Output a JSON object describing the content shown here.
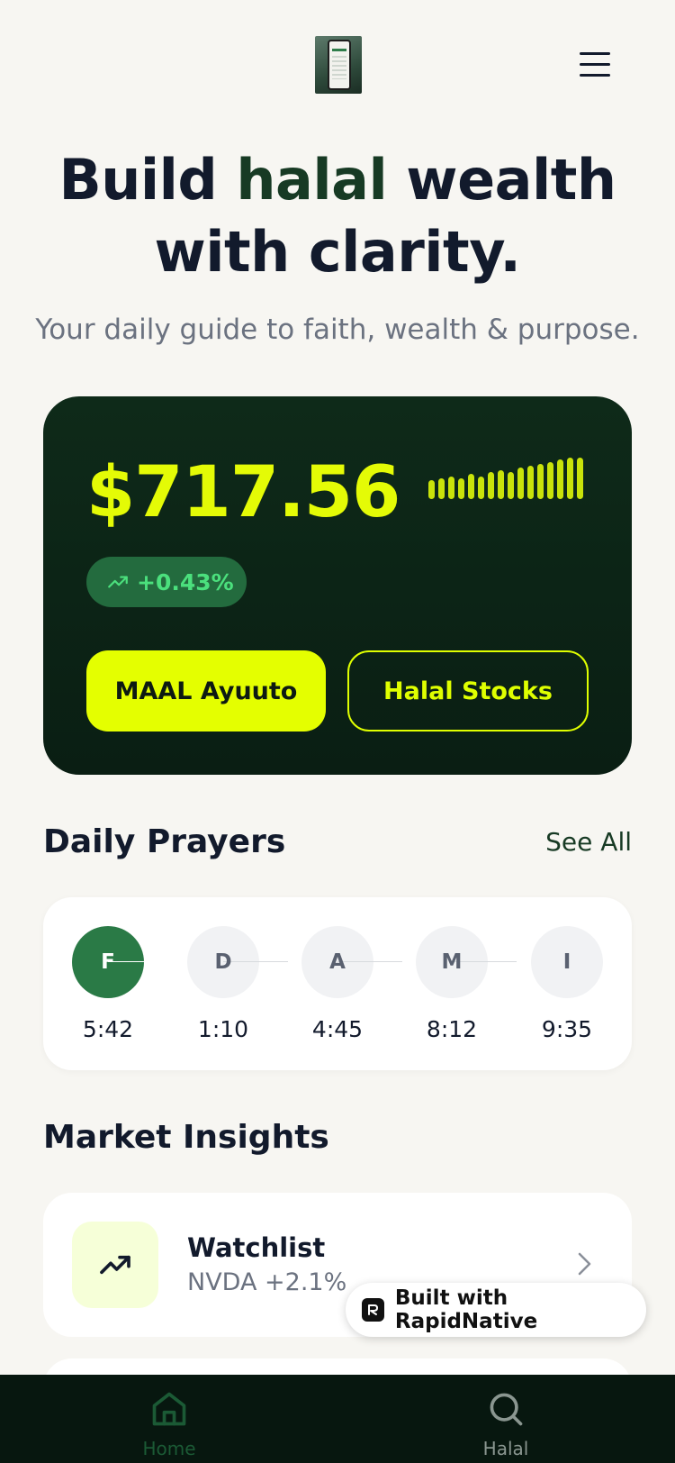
{
  "header": {
    "menu_label": "Menu"
  },
  "hero": {
    "title_part1": "Build ",
    "title_accent": "halal",
    "title_part2": " wealth",
    "title_line2": "with clarity.",
    "subtitle": "Your daily guide to faith, wealth & purpose."
  },
  "balance": {
    "amount": "$717.56",
    "change": "+0.43%",
    "primary_button": "MAAL Ayuuto",
    "secondary_button": "Halal Stocks",
    "bar_levels": [
      0.45,
      0.5,
      0.55,
      0.5,
      0.6,
      0.55,
      0.65,
      0.7,
      0.65,
      0.75,
      0.8,
      0.85,
      0.9,
      0.95,
      1.0,
      1.0
    ]
  },
  "prayers": {
    "title": "Daily Prayers",
    "see_all": "See All",
    "items": [
      {
        "letter": "F",
        "time": "5:42",
        "active": true
      },
      {
        "letter": "D",
        "time": "1:10",
        "active": false
      },
      {
        "letter": "A",
        "time": "4:45",
        "active": false
      },
      {
        "letter": "M",
        "time": "8:12",
        "active": false
      },
      {
        "letter": "I",
        "time": "9:35",
        "active": false
      }
    ]
  },
  "insights": {
    "title": "Market Insights",
    "card": {
      "title": "Watchlist",
      "subtitle": "NVDA +2.1%"
    }
  },
  "badge": {
    "text": "Built with RapidNative"
  },
  "tabs": [
    {
      "label": "Home",
      "icon": "home-icon",
      "active": true
    },
    {
      "label": "Halal",
      "icon": "search-icon",
      "active": false
    }
  ],
  "colors": {
    "accent": "#e4ff00",
    "dark_green": "#0e2a19",
    "prayer_active": "#2a7a46",
    "positive": "#4be07d",
    "tab_active": "#1b5a35",
    "tab_inactive": "#8a9690"
  }
}
